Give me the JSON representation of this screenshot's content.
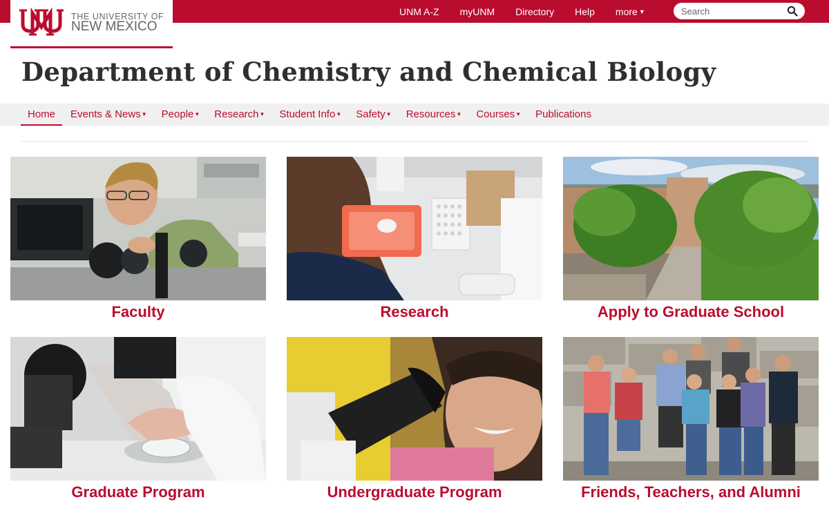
{
  "logo": {
    "line1": "THE UNIVERSITY OF",
    "line2": "NEW MEXICO",
    "brand_color": "#ba0c2f",
    "text_color": "#63666a"
  },
  "top_nav": {
    "links": [
      "UNM A-Z",
      "myUNM",
      "Directory",
      "Help"
    ],
    "more_label": "more",
    "search_placeholder": "Search"
  },
  "page_title": "Department of Chemistry and Chemical Biology",
  "main_nav": {
    "items": [
      {
        "label": "Home",
        "active": true
      },
      {
        "label": "Events & News",
        "dropdown": true
      },
      {
        "label": "People",
        "dropdown": true
      },
      {
        "label": "Research",
        "dropdown": true
      },
      {
        "label": "Student Info",
        "dropdown": true
      },
      {
        "label": "Safety",
        "dropdown": true
      },
      {
        "label": "Resources",
        "dropdown": true
      },
      {
        "label": "Courses",
        "dropdown": true
      },
      {
        "label": "Publications"
      }
    ]
  },
  "tiles": [
    {
      "caption": "Faculty",
      "photo_icon": "scientist-at-optics-bench-photo"
    },
    {
      "caption": "Research",
      "photo_icon": "lab-bench-pipetting-photo"
    },
    {
      "caption": "Apply to Graduate School",
      "photo_icon": "campus-courtyard-photo"
    },
    {
      "caption": "Graduate Program",
      "photo_icon": "microscope-petri-dish-photo"
    },
    {
      "caption": "Undergraduate Program",
      "photo_icon": "student-at-microscope-photo"
    },
    {
      "caption": "Friends, Teachers, and Alumni",
      "photo_icon": "group-photo"
    }
  ]
}
